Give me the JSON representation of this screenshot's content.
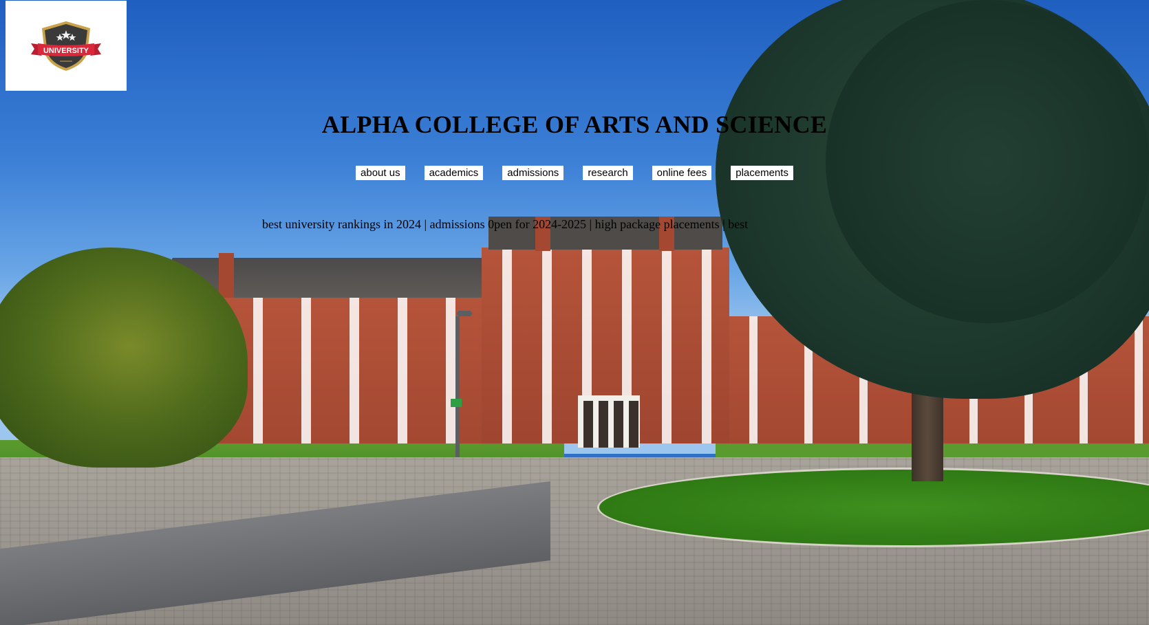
{
  "logo": {
    "text": "UNIVERSITY",
    "icon": "university-crest-icon"
  },
  "header": {
    "title": "ALPHA COLLEGE OF ARTS AND SCIENCE"
  },
  "nav": {
    "items": [
      {
        "label": "about us"
      },
      {
        "label": "academics"
      },
      {
        "label": "admissions"
      },
      {
        "label": "research"
      },
      {
        "label": "online fees"
      },
      {
        "label": "placements"
      }
    ]
  },
  "ticker": {
    "text": "best university rankings in 2024 | admissions 0pen for 2024-2025 | high package placements | best"
  },
  "colors": {
    "crest_red": "#d8283c",
    "crest_dark": "#3a3a3a",
    "crest_gold": "#c9a24a",
    "nav_bg": "#ffffff",
    "text": "#000000"
  }
}
